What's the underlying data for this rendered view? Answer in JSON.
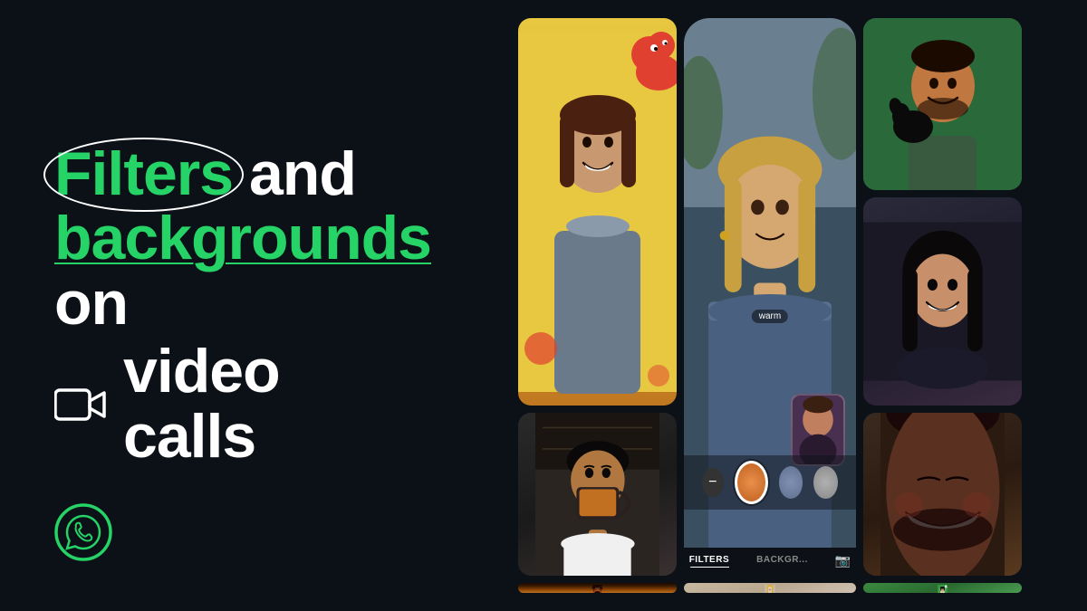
{
  "page": {
    "background_color": "#0c1118",
    "brand_color": "#25d366"
  },
  "headline": {
    "line1_prefix": "",
    "filters_word": "Filters",
    "and_word": "and",
    "backgrounds_word": "backgrounds",
    "on_word": "on",
    "video_calls": "video calls"
  },
  "filter_ui": {
    "filter_tab": "FILTERS",
    "backgrounds_tab": "BACKGR...",
    "warm_label": "warm"
  },
  "whatsapp": {
    "logo_label": "WhatsApp"
  }
}
